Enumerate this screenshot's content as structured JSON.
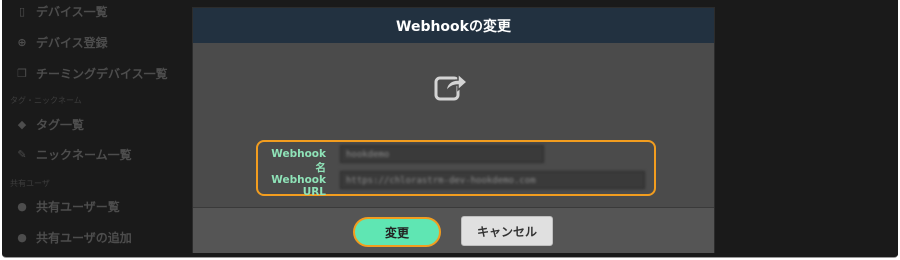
{
  "sidebar": {
    "items": [
      {
        "icon": "device-icon",
        "glyph": "▯",
        "label": "デバイス一覧"
      },
      {
        "icon": "plus-circle-icon",
        "glyph": "⊕",
        "label": "デバイス登録"
      },
      {
        "icon": "clone-icon",
        "glyph": "❐",
        "label": "チーミングデバイス一覧"
      },
      {
        "icon": "tags-icon",
        "glyph": "◆",
        "label": "タグ一覧"
      },
      {
        "icon": "pencil-icon",
        "glyph": "✎",
        "label": "ニックネーム一覧"
      },
      {
        "icon": "user-icon",
        "glyph": "●",
        "label": "共有ユーザー覧"
      },
      {
        "icon": "user-plus-icon",
        "glyph": "●",
        "label": "共有ユーザの追加"
      }
    ],
    "sections": [
      "タグ・ニックネーム",
      "共有ユーザ"
    ]
  },
  "modal": {
    "title": "Webhookの変更",
    "form": {
      "name_label": "Webhook名",
      "name_value": "hookdemo",
      "url_label": "Webhook URL",
      "url_value": "https://chlorastrm-dev-hookdemo.com"
    },
    "confirm_label": "変更",
    "cancel_label": "キャンセル"
  },
  "colors": {
    "header_bg": "#223140",
    "confirm_bg": "#5fe6b3",
    "highlight": "#f29d1f",
    "label": "#8fe3b8"
  }
}
